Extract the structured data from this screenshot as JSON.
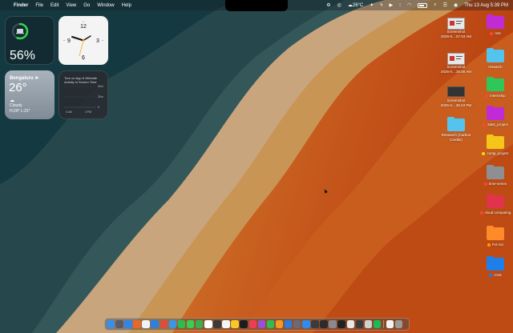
{
  "menubar": {
    "app_name": "Finder",
    "menus": [
      "File",
      "Edit",
      "View",
      "Go",
      "Window",
      "Help"
    ],
    "weather": "26°C",
    "datetime": "Thu 13 Aug  5:39 PM"
  },
  "widgets": {
    "battery": {
      "percent_label": "56%",
      "level": 0.56,
      "ring_color": "#32d74b"
    },
    "clock": {
      "hours": "10:09",
      "numerals": {
        "twelve": "12",
        "three": "3",
        "six": "6",
        "nine": "9"
      }
    },
    "weather": {
      "city": "Bengaluru",
      "temp": "26°",
      "condition": "Cloudy",
      "high_low": "H:29° L:21°"
    },
    "screen_time": {
      "message": "Turn on App & Website Activity in Screen Time",
      "ticks": [
        "60m",
        "30m",
        "0"
      ],
      "times": [
        "6 AM",
        "3 PM"
      ]
    }
  },
  "desktop": {
    "screenshots": [
      {
        "line1": "Screenshot",
        "line2": "2026-0....07.53 AM",
        "thumb": "light"
      },
      {
        "line1": "Screenshot",
        "line2": "2026-0....25.58 AM",
        "thumb": "light"
      },
      {
        "line1": "Screenshot",
        "line2": "2026-0....38.43 PM",
        "thumb": "dark"
      }
    ],
    "research_carbon": {
      "line1": "Research (Carbon",
      "line2": "Credits)",
      "color": "#54c3ee"
    },
    "folders": [
      {
        "label": "mst",
        "color": "#c02bd6",
        "tag": "#ff453a"
      },
      {
        "label": "research",
        "color": "#54c3ee",
        "tag": ""
      },
      {
        "label": "internship",
        "color": "#30c75a",
        "tag": "#ff453a"
      },
      {
        "label": "stats_project",
        "color": "#c02bd6",
        "tag": "#ff453a"
      },
      {
        "label": "comp_project",
        "color": "#f5c518",
        "tag": "#ffd60a"
      },
      {
        "label": "time-series",
        "color": "#8e8e93",
        "tag": "#ff453a"
      },
      {
        "label": "cloud computing",
        "color": "#e0344a",
        "tag": "#ff453a"
      },
      {
        "label": "Pol Sci",
        "color": "#ff8a2a",
        "tag": "#ff9f0a"
      },
      {
        "label": "CNS",
        "color": "#1f7ee8",
        "tag": "#0a84ff"
      }
    ]
  },
  "dock": {
    "apps": [
      {
        "icon": "finder-icon",
        "color": "#3a8ee6"
      },
      {
        "icon": "launchpad-icon",
        "color": "#5a5a6a"
      },
      {
        "icon": "safari-icon",
        "color": "#2f86e8"
      },
      {
        "icon": "firefox-icon",
        "color": "#e8672a"
      },
      {
        "icon": "photos-icon",
        "color": "#f2f2f2"
      },
      {
        "icon": "mail-icon",
        "color": "#2d7fe0"
      },
      {
        "icon": "chrome-icon",
        "color": "#e24a3b"
      },
      {
        "icon": "finder-2-icon",
        "color": "#3c96e8"
      },
      {
        "icon": "facetime-icon",
        "color": "#2dbd4e"
      },
      {
        "icon": "messages-icon",
        "color": "#3ccd52"
      },
      {
        "icon": "phone-icon",
        "color": "#38b04d"
      },
      {
        "icon": "calendar-icon",
        "color": "#ffffff"
      },
      {
        "icon": "notes-icon",
        "color": "#3a3a3a"
      },
      {
        "icon": "reminders-icon",
        "color": "#f5f5f5"
      },
      {
        "icon": "stickies-icon",
        "color": "#f7c928"
      },
      {
        "icon": "tv-icon",
        "color": "#1d1d1f"
      },
      {
        "icon": "music-icon",
        "color": "#f23c55"
      },
      {
        "icon": "podcasts-icon",
        "color": "#9b4fd6"
      },
      {
        "icon": "numbers-icon",
        "color": "#2fbd4f"
      },
      {
        "icon": "pages-icon",
        "color": "#f39a26"
      },
      {
        "icon": "keynote-icon",
        "color": "#2a7de1"
      },
      {
        "icon": "instruments-icon",
        "color": "#6a6a78"
      },
      {
        "icon": "app-store-icon",
        "color": "#2d8cf0"
      },
      {
        "icon": "utility-icon",
        "color": "#3b3b3b"
      },
      {
        "icon": "terminal-icon",
        "color": "#2b2b2b"
      },
      {
        "icon": "system-settings-icon",
        "color": "#8a8a8e"
      },
      {
        "icon": "activity-monitor-icon",
        "color": "#222222"
      },
      {
        "icon": "font-book-icon",
        "color": "#e8e8e8"
      },
      {
        "icon": "screen-app-icon",
        "color": "#3a3a3a"
      },
      {
        "icon": "tool-icon",
        "color": "#d0d0d0"
      },
      {
        "icon": "spotify-icon",
        "color": "#1db954"
      }
    ],
    "extras": [
      {
        "icon": "downloads-stack-icon",
        "color": "#f2f2f2"
      },
      {
        "icon": "trash-icon",
        "color": "#9a9a9a"
      }
    ]
  }
}
